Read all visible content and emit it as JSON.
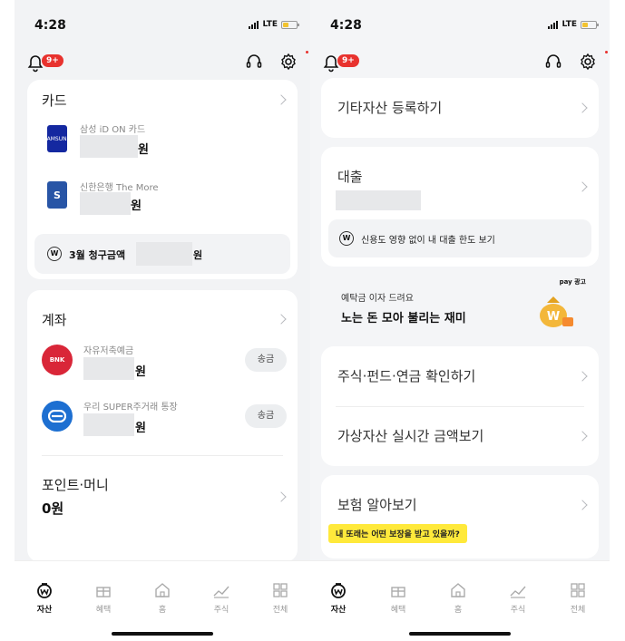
{
  "left": {
    "status": {
      "time": "4:28",
      "network": "LTE"
    },
    "topbar": {
      "badge": "9+"
    },
    "card_section": {
      "title": "카드",
      "items": [
        {
          "name": "삼성 iD ON 카드",
          "amount_suffix": "원",
          "icon_text": "SAMSUNG"
        },
        {
          "name": "신한은행 The More",
          "amount_suffix": "원",
          "icon_text": "S"
        }
      ],
      "bill_label": "3월 청구금액",
      "bill_suffix": "원"
    },
    "account_section": {
      "title": "계좌",
      "items": [
        {
          "name": "자유저축예금",
          "amount_suffix": "원",
          "icon_text": "BNK",
          "send": "송금"
        },
        {
          "name": "우리 SUPER주거래 통장",
          "amount_suffix": "원",
          "send": "송금"
        }
      ]
    },
    "point_section": {
      "title": "포인트·머니",
      "value": "0원"
    },
    "tabs": [
      "자산",
      "혜택",
      "홈",
      "주식",
      "전체"
    ]
  },
  "right": {
    "status": {
      "time": "4:28",
      "network": "LTE"
    },
    "topbar": {
      "badge": "9+"
    },
    "register": "기타자산 등록하기",
    "loan": {
      "title": "대출",
      "hint": "신용도 영향 없이 내 대출 한도 보기"
    },
    "promo": {
      "sub": "예탁금 이자 드려요",
      "title": "노는 돈 모아 불리는 재미",
      "brand": "pay 광고"
    },
    "stocks": "주식·펀드·연금 확인하기",
    "crypto": "가상자산 실시간 금액보기",
    "insurance": {
      "title": "보험 알아보기",
      "tip": "내 또래는 어떤 보장을 받고 있을까?"
    },
    "tabs": [
      "자산",
      "혜택",
      "홈",
      "주식",
      "전체"
    ]
  },
  "colors": {
    "samsung": "#1428a0",
    "shinhan": "#2855a6",
    "bnk": "#d92638",
    "woori": "#1d6fd1",
    "badge": "#e8322e",
    "tip": "#ffe93b"
  }
}
